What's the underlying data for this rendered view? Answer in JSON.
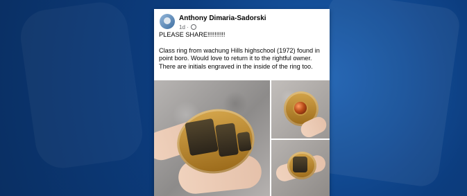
{
  "post": {
    "author_name": "Anthony Dimaria-Sadorski",
    "timestamp": "1d",
    "text": {
      "line1": "PLEASE SHARE!!!!!!!!!!",
      "line2": "Class ring from wachung Hills highschool (1972) found in point boro. Would love to return it to the rightful owner. There are initials engraved in the inside of the ring too."
    },
    "icons": {
      "avatar": "profile-avatar",
      "globe": "globe-icon"
    }
  },
  "photos": {
    "main": "ring-main-photo",
    "top_right": "ring-top-photo",
    "bottom_right": "ring-bottom-photo"
  }
}
